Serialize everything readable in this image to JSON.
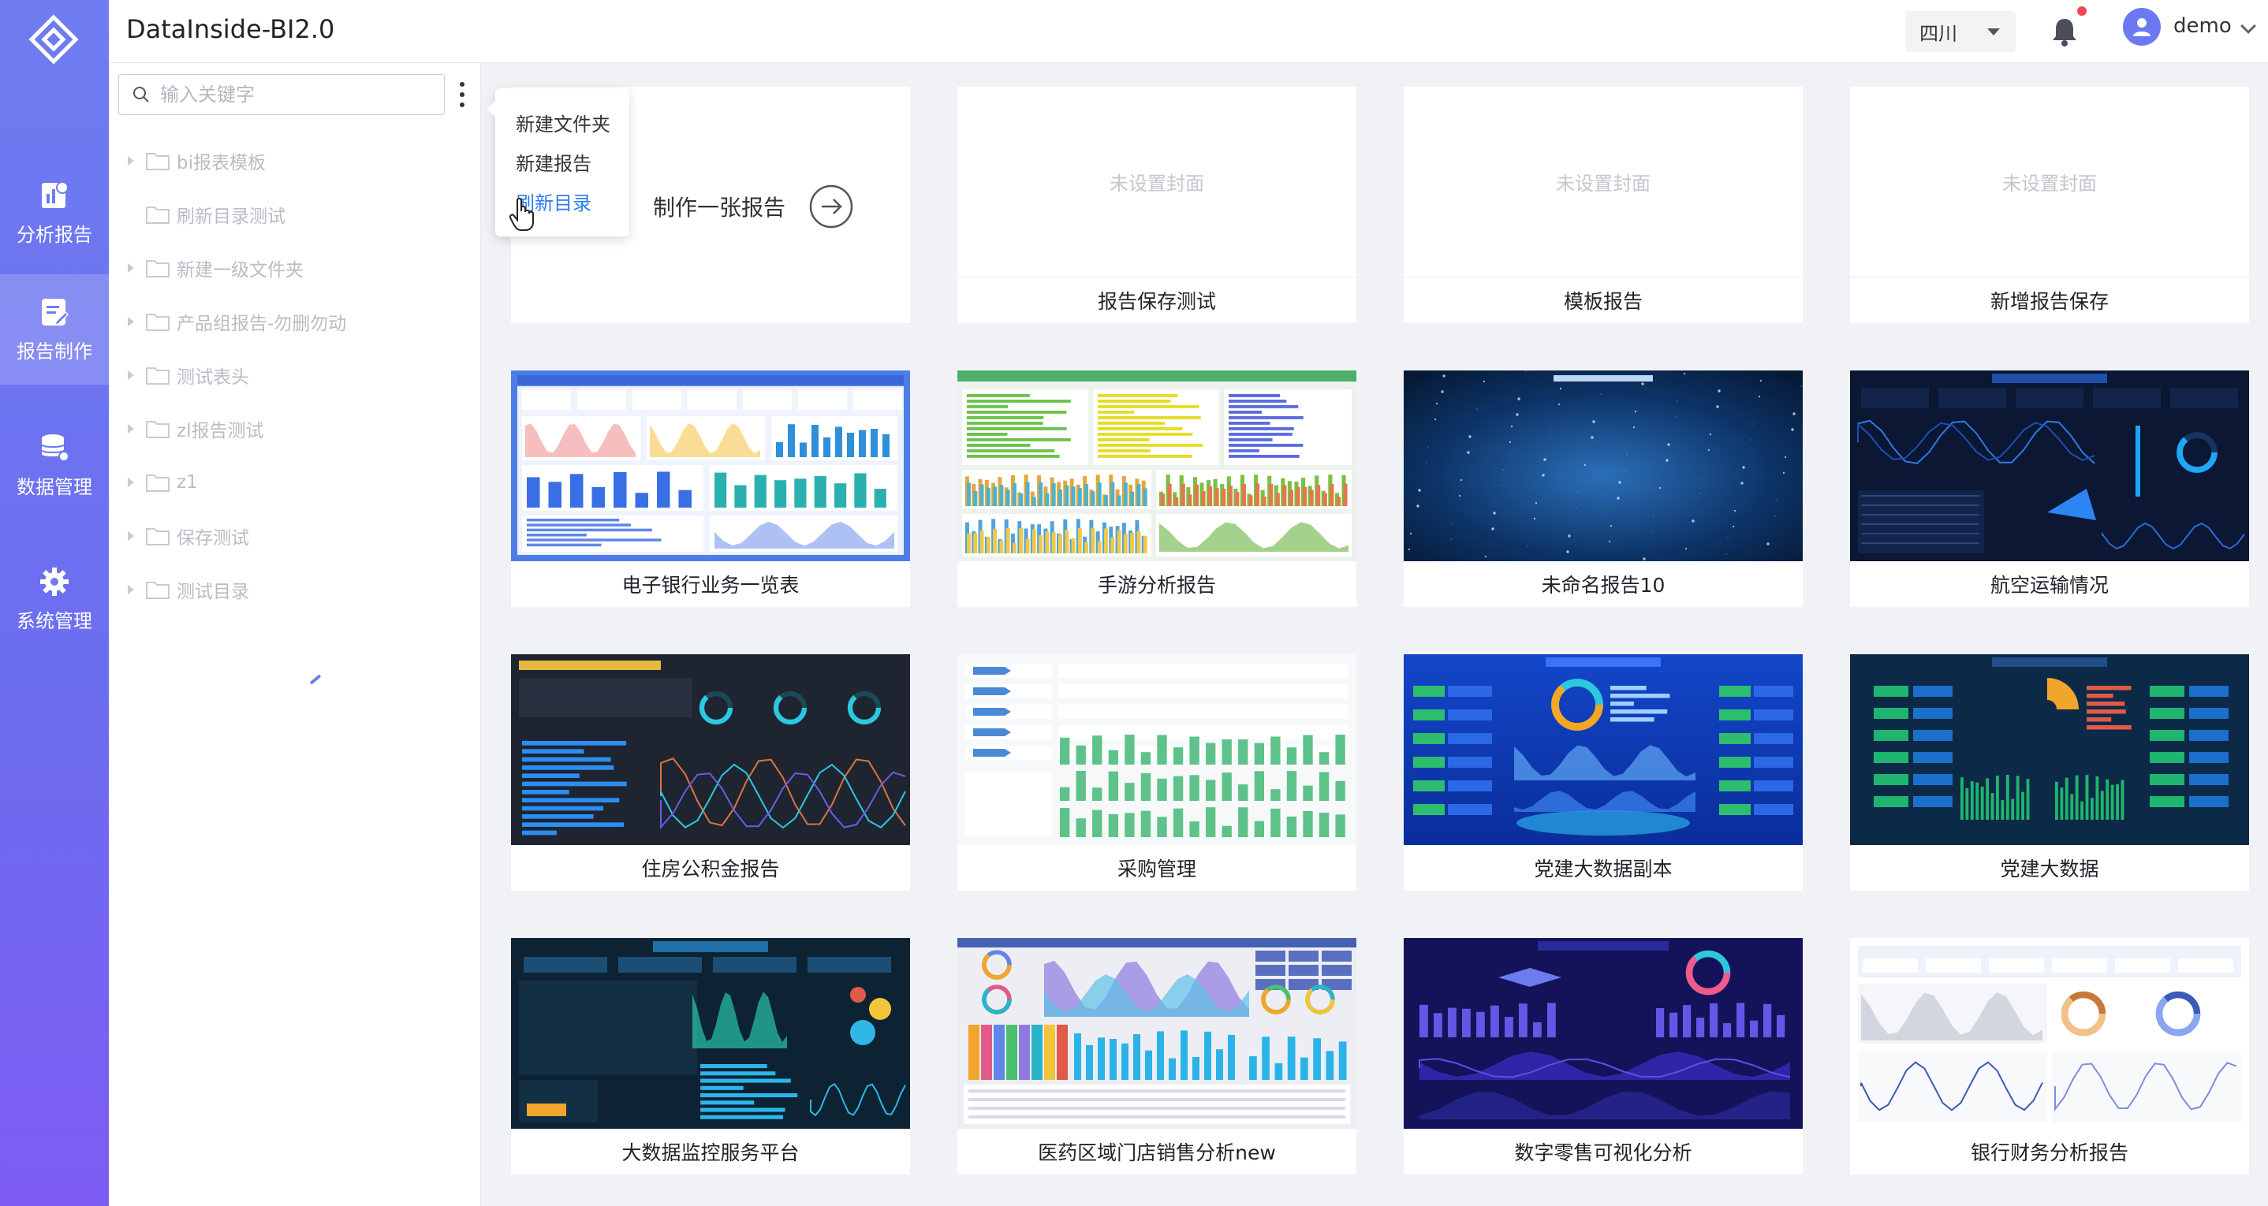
{
  "app": {
    "title": "DataInside-BI2.0"
  },
  "nav": [
    {
      "label": "分析报告",
      "icon": "analysis-report-icon"
    },
    {
      "label": "报告制作",
      "icon": "report-make-icon",
      "active": true
    },
    {
      "label": "数据管理",
      "icon": "database-icon"
    },
    {
      "label": "系统管理",
      "icon": "gear-icon"
    }
  ],
  "header": {
    "region": "四川",
    "user": "demo"
  },
  "search": {
    "placeholder": "输入关键字"
  },
  "tree": {
    "items": [
      {
        "label": "bi报表模板",
        "expandable": true
      },
      {
        "label": "刷新目录测试",
        "expandable": false
      },
      {
        "label": "新建一级文件夹",
        "expandable": true
      },
      {
        "label": "产品组报告-勿删勿动",
        "expandable": true
      },
      {
        "label": "测试表头",
        "expandable": true
      },
      {
        "label": "zl报告测试",
        "expandable": true
      },
      {
        "label": "z1",
        "expandable": true
      },
      {
        "label": "保存测试",
        "expandable": true
      },
      {
        "label": "测试目录",
        "expandable": true
      }
    ]
  },
  "menu": {
    "items": [
      "新建文件夹",
      "新建报告",
      "刷新目录"
    ],
    "hovered": 2
  },
  "new_report": {
    "label": "制作一张报告"
  },
  "cards": [
    {
      "title": "报告保存测试",
      "cover": "未设置封面",
      "theme": "none"
    },
    {
      "title": "模板报告",
      "cover": "未设置封面",
      "theme": "none"
    },
    {
      "title": "新增报告保存",
      "cover": "未设置封面",
      "theme": "none"
    },
    {
      "title": "电子银行业务一览表",
      "theme": "light-blue"
    },
    {
      "title": "手游分析报告",
      "theme": "light-green"
    },
    {
      "title": "未命名报告10",
      "theme": "space"
    },
    {
      "title": "航空运输情况",
      "theme": "dark-navy"
    },
    {
      "title": "住房公积金报告",
      "theme": "dark-gray"
    },
    {
      "title": "采购管理",
      "theme": "white-green"
    },
    {
      "title": "党建大数据副本",
      "theme": "blue"
    },
    {
      "title": "党建大数据",
      "theme": "teal-dark"
    },
    {
      "title": "大数据监控服务平台",
      "theme": "dark-teal"
    },
    {
      "title": "医药区域门店销售分析new",
      "theme": "light-gray"
    },
    {
      "title": "数字零售可视化分析",
      "theme": "indigo"
    },
    {
      "title": "银行财务分析报告",
      "theme": "white-blue"
    }
  ],
  "colors": {
    "accent": "#6d79f2",
    "link": "#2d7cf2",
    "badge": "#f5475b"
  }
}
